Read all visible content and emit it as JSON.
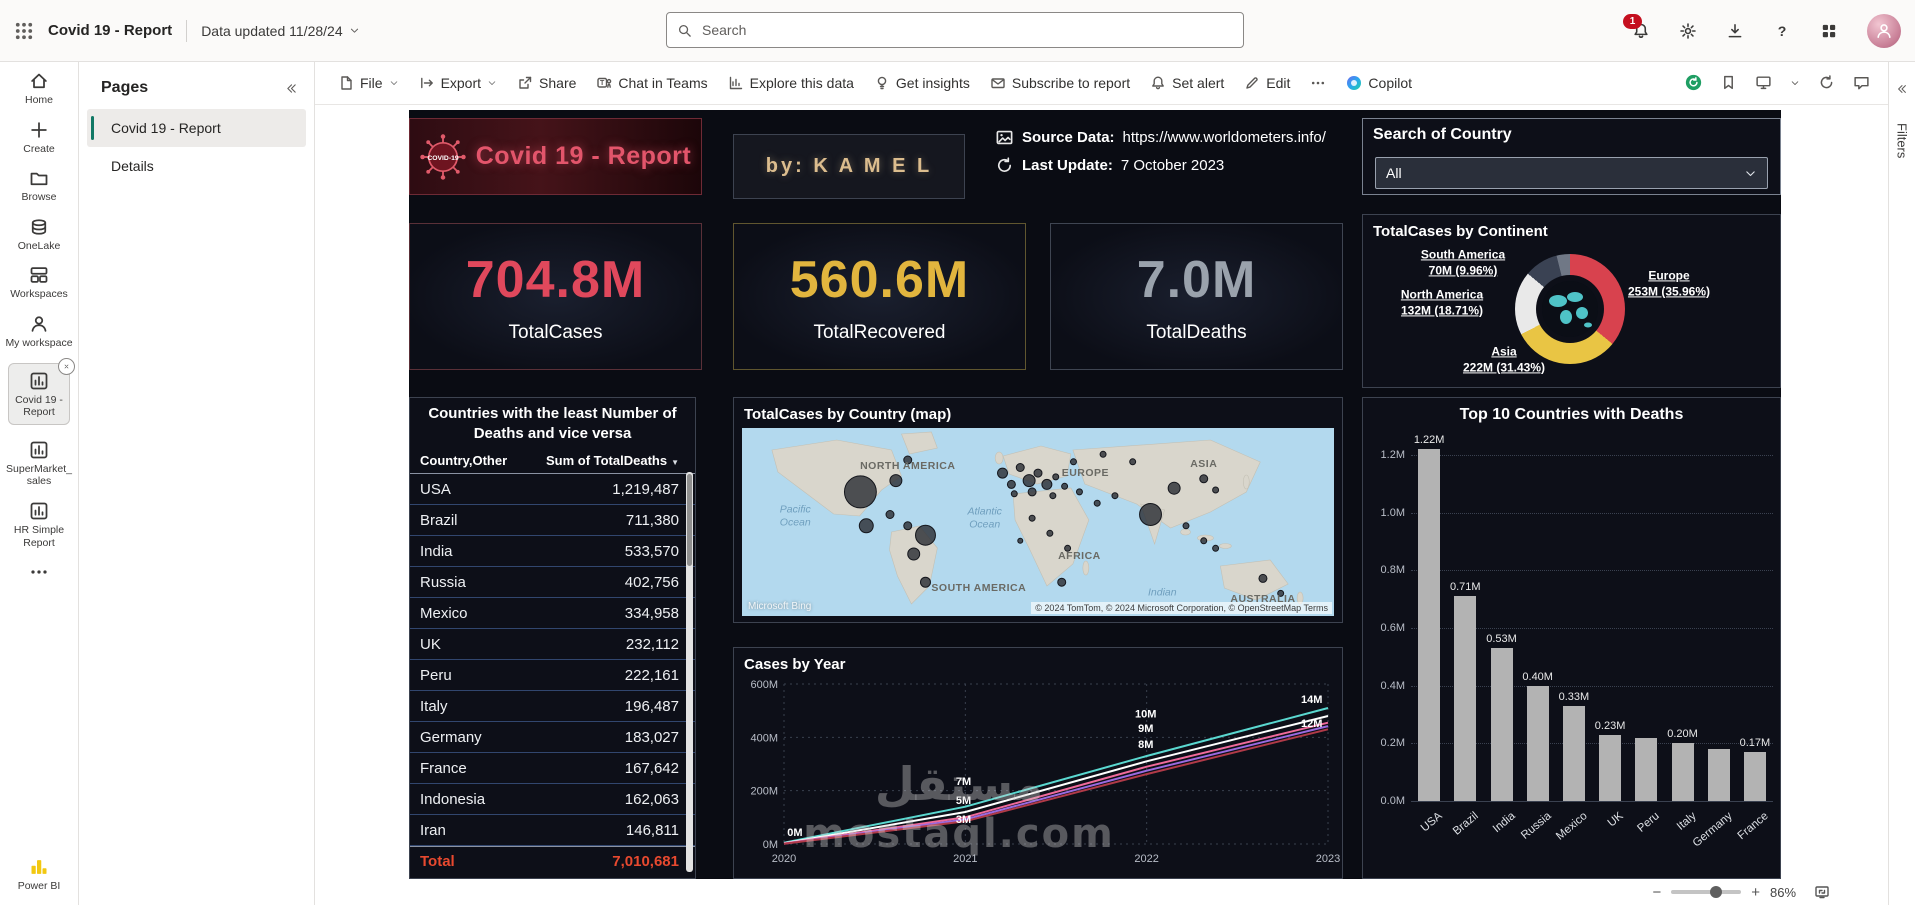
{
  "header": {
    "app_title": "Covid 19 - Report",
    "data_updated": "Data updated 11/28/24",
    "search_placeholder": "Search",
    "notification_badge": "1"
  },
  "nav_rail": {
    "items": [
      {
        "id": "home",
        "label": "Home",
        "icon": "home"
      },
      {
        "id": "create",
        "label": "Create",
        "icon": "plus"
      },
      {
        "id": "browse",
        "label": "Browse",
        "icon": "folder"
      },
      {
        "id": "onelake",
        "label": "OneLake",
        "icon": "onelake"
      },
      {
        "id": "workspaces",
        "label": "Workspaces",
        "icon": "workspaces"
      },
      {
        "id": "my-workspace",
        "label": "My workspace",
        "icon": "person"
      },
      {
        "id": "covid-19-report",
        "label": "Covid 19 - Report",
        "icon": "report",
        "selected": true,
        "closable": true
      },
      {
        "id": "supermarket-sales",
        "label": "SuperMarket_sales",
        "icon": "report"
      },
      {
        "id": "hr-simple-report",
        "label": "HR Simple Report",
        "icon": "report"
      },
      {
        "id": "more",
        "label": "",
        "icon": "more"
      }
    ],
    "footer_label": "Power BI"
  },
  "pages_panel": {
    "title": "Pages",
    "items": [
      {
        "label": "Covid 19 - Report",
        "selected": true
      },
      {
        "label": "Details",
        "selected": false
      }
    ]
  },
  "toolbar": {
    "items": [
      {
        "label": "File",
        "icon": "file",
        "chevron": true
      },
      {
        "label": "Export",
        "icon": "export",
        "chevron": true
      },
      {
        "label": "Share",
        "icon": "share"
      },
      {
        "label": "Chat in Teams",
        "icon": "teams"
      },
      {
        "label": "Explore this data",
        "icon": "explore"
      },
      {
        "label": "Get insights",
        "icon": "insights"
      },
      {
        "label": "Subscribe to report",
        "icon": "subscribe"
      },
      {
        "label": "Set alert",
        "icon": "alert"
      },
      {
        "label": "Edit",
        "icon": "edit"
      },
      {
        "label": "",
        "icon": "more"
      },
      {
        "label": "Copilot",
        "icon": "copilot"
      }
    ],
    "right_icons": [
      {
        "icon": "sync",
        "name": "sync-status"
      },
      {
        "icon": "bookmark",
        "name": "bookmarks"
      },
      {
        "icon": "view",
        "name": "view-options"
      },
      {
        "icon": "chevdown",
        "name": "view-chevron"
      },
      {
        "icon": "refresh",
        "name": "refresh-visuals"
      },
      {
        "icon": "comment",
        "name": "comments"
      }
    ]
  },
  "filters_pane": {
    "label": "Filters"
  },
  "status_bar": {
    "zoom": "86%"
  },
  "report": {
    "logo_text": "COVID-19",
    "title": "Covid 19 - Report",
    "byline": "by: K A M E L",
    "source": {
      "label": "Source Data:",
      "value": "https://www.worldometers.info/"
    },
    "update": {
      "label": "Last Update:",
      "value": "7 October 2023"
    },
    "country_search": {
      "title": "Search of Country",
      "value": "All"
    },
    "kpis": [
      {
        "value": "704.8M",
        "label": "TotalCases",
        "color": "#e0485c",
        "border": "#5a3038"
      },
      {
        "value": "560.6M",
        "label": "TotalRecovered",
        "color": "#e2b53e",
        "border": "#60562f"
      },
      {
        "value": "7.0M",
        "label": "TotalDeaths",
        "color": "#9aa2ac",
        "border": "#3f4552"
      }
    ],
    "watermark": {
      "line1": "مستقل",
      "line2": "mostaql.com"
    }
  },
  "chart_data": [
    {
      "id": "totalcases-by-continent",
      "type": "pie",
      "title": "TotalCases by Continent",
      "segments": [
        {
          "name": "Europe",
          "value": "253M",
          "percent": 35.96,
          "color": "#d8424e"
        },
        {
          "name": "Asia",
          "value": "222M",
          "percent": 31.43,
          "color": "#e9c544"
        },
        {
          "name": "North America",
          "value": "132M",
          "percent": 18.71,
          "color": "#e9e9e9"
        },
        {
          "name": "South America",
          "value": "70M",
          "percent": 9.96,
          "color": "#3a4253"
        },
        {
          "name": "Other",
          "value": "",
          "percent": 3.94,
          "color": "#707886"
        }
      ],
      "labels": [
        {
          "name": "South America",
          "value": "70M (9.96%)",
          "x": 100,
          "y": 48
        },
        {
          "name": "Europe",
          "value": "253M (35.96%)",
          "x": 306,
          "y": 69
        },
        {
          "name": "North America",
          "value": "132M (18.71%)",
          "x": 79,
          "y": 88
        },
        {
          "name": "Asia",
          "value": "222M (31.43%)",
          "x": 141,
          "y": 145
        }
      ]
    },
    {
      "id": "deaths-table",
      "type": "table",
      "title": "Countries with the least Number of Deaths and vice versa",
      "columns": [
        "Country,Other",
        "Sum of TotalDeaths"
      ],
      "rows": [
        [
          "USA",
          "1,219,487"
        ],
        [
          "Brazil",
          "711,380"
        ],
        [
          "India",
          "533,570"
        ],
        [
          "Russia",
          "402,756"
        ],
        [
          "Mexico",
          "334,958"
        ],
        [
          "UK",
          "232,112"
        ],
        [
          "Peru",
          "222,161"
        ],
        [
          "Italy",
          "196,487"
        ],
        [
          "Germany",
          "183,027"
        ],
        [
          "France",
          "167,642"
        ],
        [
          "Indonesia",
          "162,063"
        ],
        [
          "Iran",
          "146,811"
        ]
      ],
      "total": [
        "Total",
        "7,010,681"
      ]
    },
    {
      "id": "cases-map",
      "type": "map",
      "title": "TotalCases by Country (map)",
      "region_labels": [
        {
          "text": "NORTH AMERICA",
          "x": 28,
          "y": 20
        },
        {
          "text": "EUROPE",
          "x": 58,
          "y": 24
        },
        {
          "text": "ASIA",
          "x": 78,
          "y": 19
        },
        {
          "text": "AFRICA",
          "x": 57,
          "y": 68
        },
        {
          "text": "SOUTH AMERICA",
          "x": 40,
          "y": 85
        },
        {
          "text": "AUSTRALIA",
          "x": 88,
          "y": 91
        }
      ],
      "ocean_labels": [
        {
          "text": "Pacific Ocean",
          "x": 9,
          "y": 47
        },
        {
          "text": "Atlantic Ocean",
          "x": 41,
          "y": 48
        },
        {
          "text": "Indian",
          "x": 71,
          "y": 88
        }
      ],
      "attribution_left": "Microsoft Bing",
      "attribution_right": "© 2024 TomTom, © 2024 Microsoft Corporation, © OpenStreetMap  Terms",
      "bubbles": [
        [
          20,
          34,
          16
        ],
        [
          26,
          28,
          6
        ],
        [
          28,
          17,
          4
        ],
        [
          21,
          52,
          7
        ],
        [
          25,
          46,
          4
        ],
        [
          31,
          57,
          10
        ],
        [
          29,
          67,
          6
        ],
        [
          31,
          82,
          5
        ],
        [
          28,
          52,
          4
        ],
        [
          44,
          24,
          5
        ],
        [
          45.5,
          30,
          4
        ],
        [
          47,
          21,
          4
        ],
        [
          48.5,
          28,
          6
        ],
        [
          50,
          24,
          4
        ],
        [
          51.5,
          30,
          5
        ],
        [
          49,
          34,
          4
        ],
        [
          46,
          35,
          3
        ],
        [
          53,
          26,
          3
        ],
        [
          54.5,
          31,
          3
        ],
        [
          52.5,
          36,
          3
        ],
        [
          56,
          18,
          3
        ],
        [
          61,
          14,
          3
        ],
        [
          66,
          18,
          3
        ],
        [
          57,
          34,
          3
        ],
        [
          60,
          40,
          3
        ],
        [
          63,
          36,
          3
        ],
        [
          69,
          46,
          11
        ],
        [
          73,
          32,
          6
        ],
        [
          78,
          27,
          4
        ],
        [
          80,
          33,
          3
        ],
        [
          75,
          52,
          3
        ],
        [
          78,
          60,
          3
        ],
        [
          80,
          64,
          3
        ],
        [
          49,
          48,
          3
        ],
        [
          52,
          56,
          3
        ],
        [
          55,
          64,
          3
        ],
        [
          54,
          82,
          4
        ],
        [
          47,
          60,
          2.5
        ],
        [
          88,
          80,
          4
        ],
        [
          91,
          88,
          3
        ]
      ]
    },
    {
      "id": "cases-by-year",
      "type": "line",
      "title": "Cases by Year",
      "x": [
        "2020",
        "2021",
        "2022",
        "2023"
      ],
      "ylim": [
        0,
        600
      ],
      "yticks": [
        "0M",
        "200M",
        "400M",
        "600M"
      ],
      "series": [
        {
          "name": "series-teal",
          "color": "#5ad8d0",
          "values": [
            5,
            140,
            330,
            510
          ]
        },
        {
          "name": "series-white",
          "color": "#ffffff",
          "values": [
            3,
            120,
            310,
            480
          ]
        },
        {
          "name": "series-pink",
          "color": "#f06a9a",
          "values": [
            2,
            100,
            290,
            455
          ]
        },
        {
          "name": "series-purple",
          "color": "#9a6ae0",
          "values": [
            1,
            92,
            275,
            442
          ]
        },
        {
          "name": "series-crimson",
          "color": "#b03a48",
          "values": [
            1,
            85,
            262,
            430
          ]
        }
      ],
      "point_labels": [
        {
          "text": "0M",
          "fx": 0.02,
          "fy": 0.95
        },
        {
          "text": "3M",
          "fx": 0.33,
          "fy": 0.87
        },
        {
          "text": "5M",
          "fx": 0.33,
          "fy": 0.75
        },
        {
          "text": "7M",
          "fx": 0.33,
          "fy": 0.63
        },
        {
          "text": "8M",
          "fx": 0.665,
          "fy": 0.4
        },
        {
          "text": "9M",
          "fx": 0.665,
          "fy": 0.3
        },
        {
          "text": "10M",
          "fx": 0.665,
          "fy": 0.21
        },
        {
          "text": "12M",
          "fx": 0.97,
          "fy": 0.27
        },
        {
          "text": "14M",
          "fx": 0.97,
          "fy": 0.12
        }
      ]
    },
    {
      "id": "top-10-countries-with-deaths",
      "type": "bar",
      "title": "Top 10 Countries with Deaths",
      "categories": [
        "USA",
        "Brazil",
        "India",
        "Russia",
        "Mexico",
        "UK",
        "Peru",
        "Italy",
        "Germany",
        "France"
      ],
      "values": [
        1.22,
        0.71,
        0.53,
        0.4,
        0.33,
        0.23,
        0.22,
        0.2,
        0.18,
        0.17
      ],
      "labels": [
        "1.22M",
        "0.71M",
        "0.53M",
        "0.40M",
        "0.33M",
        "0.23M",
        "",
        "0.20M",
        "",
        "0.17M"
      ],
      "ylim": [
        0,
        1.2
      ],
      "yticks": [
        "0.0M",
        "0.2M",
        "0.4M",
        "0.6M",
        "0.8M",
        "1.0M",
        "1.2M"
      ],
      "bar_color": "#b3b3b3"
    }
  ]
}
